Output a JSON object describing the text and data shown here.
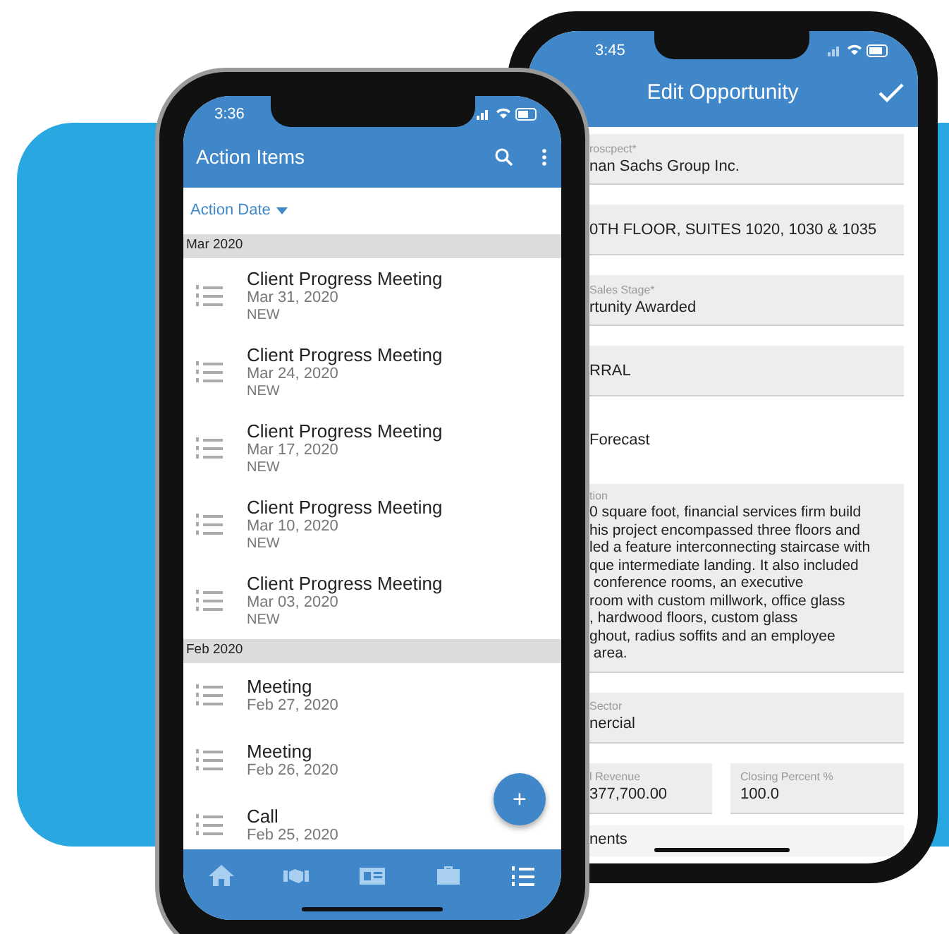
{
  "back_phone": {
    "status_bar": {
      "time": "3:45"
    },
    "header": {
      "title": "Edit Opportunity"
    },
    "fields": [
      {
        "kind": "field",
        "label": "roscpect*",
        "value": "nan Sachs Group Inc."
      },
      {
        "kind": "field",
        "value": "0TH FLOOR, SUITES 1020, 1030 & 1035"
      },
      {
        "kind": "field",
        "label": "Sales Stage*",
        "value": "rtunity Awarded"
      },
      {
        "kind": "field",
        "value": "RRAL"
      },
      {
        "kind": "plain",
        "value": "Forecast"
      },
      {
        "kind": "textarea",
        "label": "tion",
        "lines": [
          "0 square foot, financial services firm build",
          "his project encompassed three floors and",
          "led a feature interconnecting staircase with",
          "que intermediate landing. It also included",
          " conference rooms, an executive",
          "room with custom millwork, office glass",
          ", hardwood floors, custom glass",
          "ghout, radius soffits and an employee",
          " area."
        ]
      },
      {
        "kind": "field",
        "label": "Sector",
        "value": "nercial"
      },
      {
        "kind": "pair",
        "items": [
          {
            "label": "l Revenue",
            "value": "377,700.00"
          },
          {
            "label": "Closing Percent %",
            "value": "100.0"
          }
        ]
      },
      {
        "kind": "section",
        "value": "nents"
      }
    ]
  },
  "front_phone": {
    "status_bar": {
      "time": "3:36"
    },
    "header": {
      "title": "Action Items"
    },
    "sort": {
      "label": "Action Date"
    },
    "groups": [
      {
        "title": "Mar 2020",
        "items": [
          {
            "title": "Client Progress Meeting",
            "date": "Mar 31, 2020",
            "status": "NEW"
          },
          {
            "title": "Client Progress Meeting",
            "date": "Mar 24, 2020",
            "status": "NEW"
          },
          {
            "title": "Client Progress Meeting",
            "date": "Mar 17, 2020",
            "status": "NEW"
          },
          {
            "title": "Client Progress Meeting",
            "date": "Mar 10, 2020",
            "status": "NEW"
          },
          {
            "title": "Client Progress Meeting",
            "date": "Mar 03, 2020",
            "status": "NEW"
          }
        ]
      },
      {
        "title": "Feb 2020",
        "items": [
          {
            "title": "Meeting",
            "date": "Feb 27, 2020"
          },
          {
            "title": "Meeting",
            "date": "Feb 26, 2020"
          },
          {
            "title": "Call",
            "date": "Feb 25, 2020"
          }
        ]
      }
    ],
    "fab": {
      "label": "+"
    },
    "bottom_nav": [
      {
        "selected": false
      },
      {
        "selected": false
      },
      {
        "selected": false
      },
      {
        "selected": false
      },
      {
        "selected": true
      }
    ]
  }
}
